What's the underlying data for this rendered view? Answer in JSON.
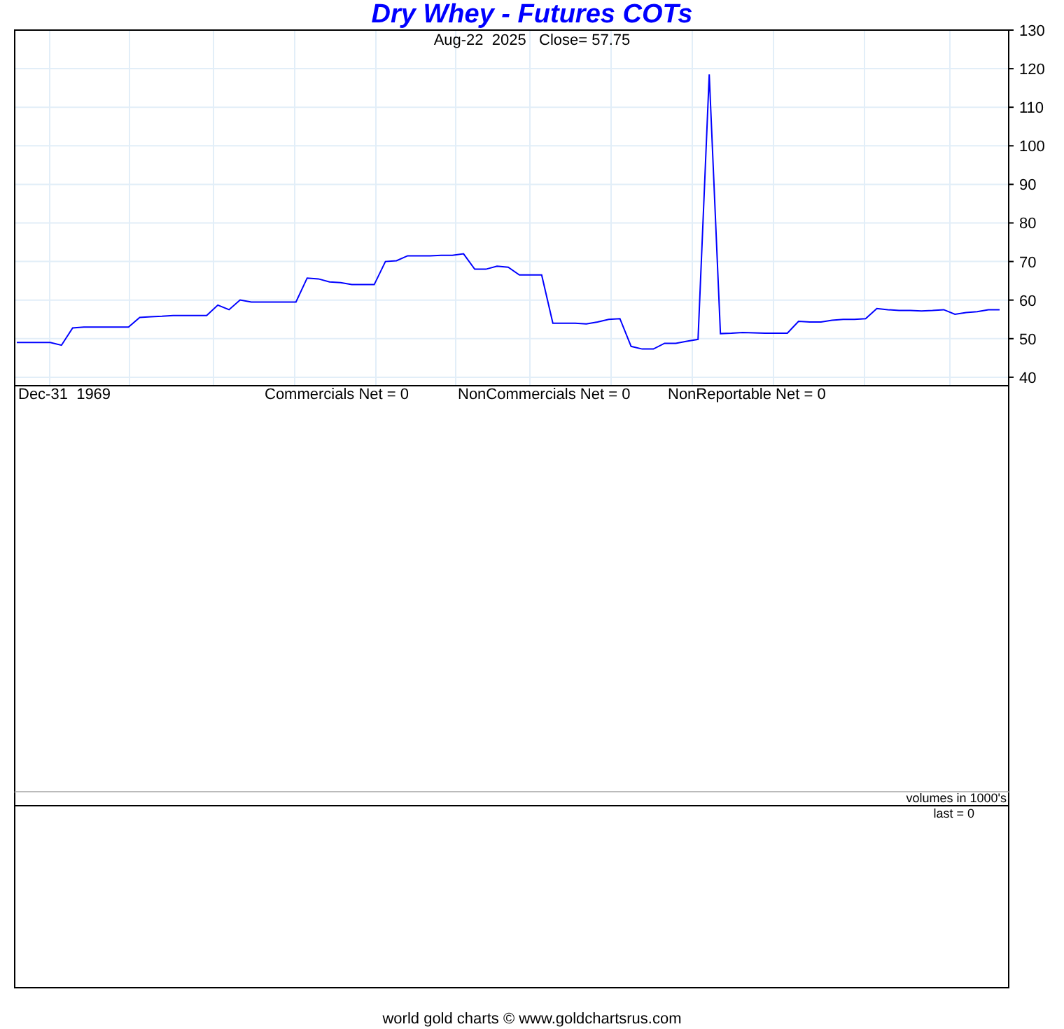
{
  "title": "Dry Whey - Futures COTs",
  "price_panel": {
    "subtitle": "Aug-22  2025   Close= 57.75",
    "chart_data": {
      "type": "line",
      "grid": true,
      "categories": [
        null,
        null,
        null,
        null,
        null,
        null,
        null,
        null,
        null,
        null,
        null,
        null,
        null,
        null,
        null,
        null,
        null,
        null,
        null,
        null,
        null,
        null,
        null,
        null,
        null,
        null,
        null,
        null,
        null,
        null,
        null,
        null,
        null,
        null,
        null,
        null,
        null,
        null,
        null,
        null,
        null,
        null,
        null,
        null,
        null,
        null,
        null,
        null,
        null,
        null,
        null,
        null,
        null,
        null,
        null,
        null,
        null,
        null,
        null,
        null,
        null,
        null,
        null,
        null,
        null,
        null,
        null,
        null,
        null,
        null,
        null,
        null,
        null,
        null,
        null,
        null,
        null,
        null,
        null,
        null,
        null,
        null,
        null,
        null,
        null,
        null,
        null,
        null,
        null
      ],
      "ylim": [
        37.8,
        130
      ],
      "yticks": [
        40,
        50,
        60,
        70,
        80,
        90,
        100,
        110,
        120,
        130
      ],
      "series": [
        {
          "color": "#0000ff",
          "values": [
            49,
            49,
            49,
            49,
            48.3,
            52.8,
            53,
            53,
            53,
            53,
            53,
            55.5,
            55.7,
            55.8,
            56,
            56,
            56,
            56,
            58.7,
            57.5,
            60,
            59.5,
            59.5,
            59.5,
            59.5,
            59.5,
            65.7,
            65.5,
            64.7,
            64.5,
            64,
            64,
            64,
            70,
            70.2,
            71.5,
            71.5,
            71.5,
            71.6,
            71.6,
            72,
            68,
            68,
            68.8,
            68.5,
            66.5,
            66.5,
            66.5,
            54,
            54,
            54,
            53.8,
            54.3,
            55,
            55.2,
            48,
            47.3,
            47.3,
            48.8,
            48.8,
            49.3,
            49.8,
            118.5,
            51.3,
            51.4,
            51.6,
            51.5,
            51.4,
            51.4,
            51.4,
            54.5,
            54.3,
            54.3,
            54.8,
            55,
            55,
            55.2,
            57.8,
            57.5,
            57.3,
            57.3,
            57.2,
            57.3,
            57.5,
            56.3,
            56.8,
            57,
            57.5,
            57.5
          ]
        }
      ]
    }
  },
  "cot_panel": {
    "date": "Dec-31  1969",
    "readings": [
      "Commercials Net = 0",
      "NonCommercials Net = 0",
      "NonReportable Net = 0"
    ]
  },
  "volume_panel": {
    "caption": "volumes in 1000's",
    "last": "last = 0"
  },
  "footer": "world gold charts © www.goldchartsrus.com"
}
